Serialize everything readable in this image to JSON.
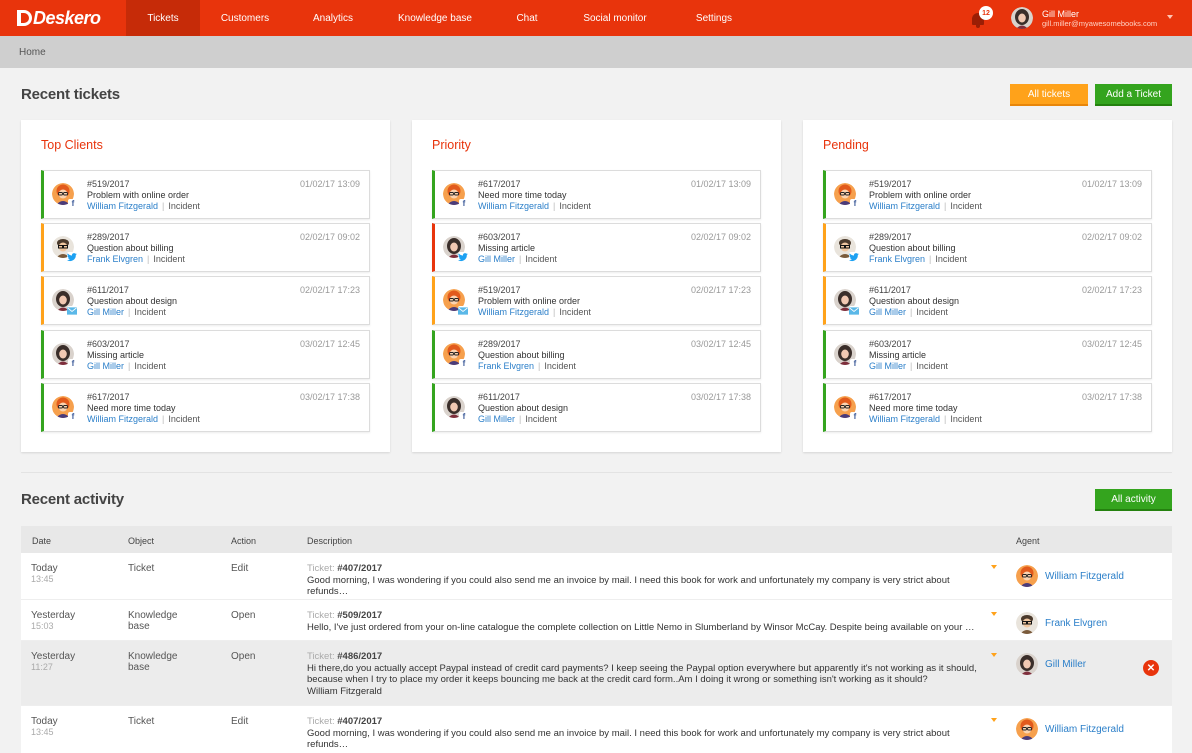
{
  "app": {
    "logo_text": "Deskero",
    "brand_color": "#e8340c"
  },
  "nav": {
    "items": [
      {
        "label": "Tickets",
        "active": true
      },
      {
        "label": "Customers"
      },
      {
        "label": "Analytics"
      },
      {
        "label": "Knowledge base"
      },
      {
        "label": "Chat"
      },
      {
        "label": "Social monitor"
      },
      {
        "label": "Settings"
      }
    ]
  },
  "notifications": {
    "count": "12",
    "icon": "bell-icon"
  },
  "user": {
    "name": "Gill Miller",
    "email": "gill.miller@myawesomebooks.com"
  },
  "breadcrumb": {
    "label": "Home"
  },
  "recent_tickets": {
    "title": "Recent tickets",
    "all_tickets_label": "All tickets",
    "add_ticket_label": "Add a Ticket",
    "columns": [
      {
        "title": "Top Clients",
        "tickets": [
          {
            "number": "#519/2017",
            "subject": "Problem with online order",
            "customer": "William Fitzgerald",
            "type": "Incident",
            "date": "01/02/17  13:09",
            "source": "facebook",
            "status": "green",
            "avatar": "orange"
          },
          {
            "number": "#289/2017",
            "subject": "Question about billing",
            "customer": "Frank Elvgren",
            "type": "Incident",
            "date": "02/02/17  09:02",
            "source": "twitter",
            "status": "orange",
            "avatar": "glasses"
          },
          {
            "number": "#611/2017",
            "subject": "Question about design",
            "customer": "Gill Miller",
            "type": "Incident",
            "date": "02/02/17  17:23",
            "source": "email",
            "status": "orange",
            "avatar": "woman"
          },
          {
            "number": "#603/2017",
            "subject": "Missing article",
            "customer": "Gill Miller",
            "type": "Incident",
            "date": "03/02/17  12:45",
            "source": "facebook",
            "status": "green",
            "avatar": "woman"
          },
          {
            "number": "#617/2017",
            "subject": "Need more time today",
            "customer": "William Fitzgerald",
            "type": "Incident",
            "date": "03/02/17  17:38",
            "source": "facebook",
            "status": "green",
            "avatar": "orange"
          }
        ]
      },
      {
        "title": "Priority",
        "tickets": [
          {
            "number": "#617/2017",
            "subject": "Need more time today",
            "customer": "William Fitzgerald",
            "type": "Incident",
            "date": "01/02/17  13:09",
            "source": "facebook",
            "status": "green",
            "avatar": "orange"
          },
          {
            "number": "#603/2017",
            "subject": "Missing article",
            "customer": "Gill Miller",
            "type": "Incident",
            "date": "02/02/17  09:02",
            "source": "twitter",
            "status": "red",
            "avatar": "woman"
          },
          {
            "number": "#519/2017",
            "subject": "Problem with online order",
            "customer": "William Fitzgerald",
            "type": "Incident",
            "date": "02/02/17  17:23",
            "source": "email",
            "status": "orange",
            "avatar": "orange"
          },
          {
            "number": "#289/2017",
            "subject": "Question about billing",
            "customer": "Frank Elvgren",
            "type": "Incident",
            "date": "03/02/17  12:45",
            "source": "facebook",
            "status": "green",
            "avatar": "orange"
          },
          {
            "number": "#611/2017",
            "subject": "Question about design",
            "customer": "Gill Miller",
            "type": "Incident",
            "date": "03/02/17  17:38",
            "source": "facebook",
            "status": "green",
            "avatar": "woman"
          }
        ]
      },
      {
        "title": "Pending",
        "tickets": [
          {
            "number": "#519/2017",
            "subject": "Problem with online order",
            "customer": "William Fitzgerald",
            "type": "Incident",
            "date": "01/02/17  13:09",
            "source": "facebook",
            "status": "green",
            "avatar": "orange"
          },
          {
            "number": "#289/2017",
            "subject": "Question about billing",
            "customer": "Frank Elvgren",
            "type": "Incident",
            "date": "02/02/17  09:02",
            "source": "twitter",
            "status": "orange",
            "avatar": "glasses"
          },
          {
            "number": "#611/2017",
            "subject": "Question about design",
            "customer": "Gill Miller",
            "type": "Incident",
            "date": "02/02/17  17:23",
            "source": "email",
            "status": "orange",
            "avatar": "woman"
          },
          {
            "number": "#603/2017",
            "subject": "Missing article",
            "customer": "Gill Miller",
            "type": "Incident",
            "date": "03/02/17  12:45",
            "source": "facebook",
            "status": "green",
            "avatar": "woman"
          },
          {
            "number": "#617/2017",
            "subject": "Need more time today",
            "customer": "William Fitzgerald",
            "type": "Incident",
            "date": "03/02/17  17:38",
            "source": "facebook",
            "status": "green",
            "avatar": "orange"
          }
        ]
      }
    ]
  },
  "recent_activity": {
    "title": "Recent activity",
    "all_activity_label": "All activity",
    "headers": {
      "date": "Date",
      "object": "Object",
      "action": "Action",
      "description": "Description",
      "agent": "Agent"
    },
    "rows": [
      {
        "day": "Today",
        "time": "13:45",
        "object": "Ticket",
        "object2": "",
        "action": "Edit",
        "ticket_prefix": "Ticket:",
        "ticket": "#407/2017",
        "text": "Good morning, I was wondering if you could also send me an invoice by mail. I need this book for work and unfortunately my company is very strict about refunds…",
        "text2": "",
        "text3": "",
        "agent": "William Fitzgerald",
        "avatar": "orange"
      },
      {
        "day": "Yesterday",
        "time": "15:03",
        "object": "Knowledge",
        "object2": "base",
        "action": "Open",
        "ticket_prefix": "Ticket:",
        "ticket": "#509/2017",
        "text": "Hello, I've just ordered from your on-line catalogue the complete collection on Little Nemo in Slumberland by Winsor McCay. Despite being available on your …",
        "text2": "",
        "text3": "",
        "agent": "Frank Elvgren",
        "avatar": "glasses"
      },
      {
        "day": "Yesterday",
        "time": "11:27",
        "object": "Knowledge",
        "object2": "base",
        "action": "Open",
        "ticket_prefix": "Ticket:",
        "ticket": "#486/2017",
        "text": "Hi there,do you actually accept Paypal instead of credit card payments? I keep seeing the Paypal option everywhere but apparently it's not working as it should,",
        "text2": "because when I try to place my order it keeps bouncing me back at the credit card form..Am I doing it wrong or something isn't working as it should?",
        "text3": "William Fitzgerald",
        "agent": "Gill Miller",
        "avatar": "woman"
      },
      {
        "day": "Today",
        "time": "13:45",
        "object": "Ticket",
        "object2": "",
        "action": "Edit",
        "ticket_prefix": "Ticket:",
        "ticket": "#407/2017",
        "text": "Good morning, I was wondering if you could also send me an invoice by mail. I need this book for work and unfortunately my company is very strict about refunds…",
        "text2": "",
        "text3": "",
        "agent": "William Fitzgerald",
        "avatar": "orange"
      }
    ]
  }
}
